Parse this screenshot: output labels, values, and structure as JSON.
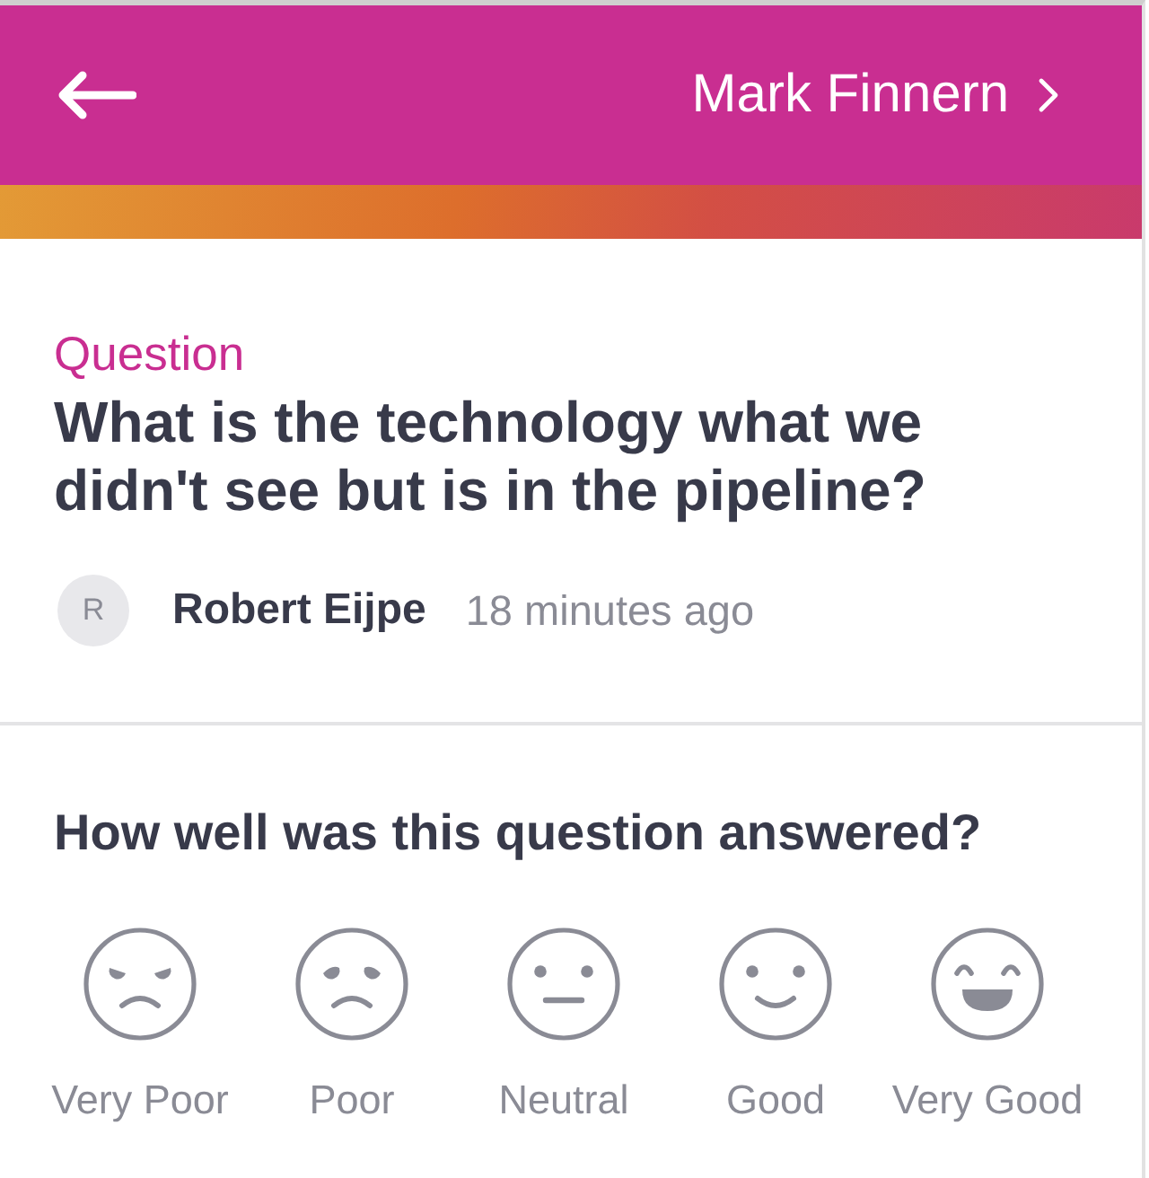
{
  "header": {
    "profile_name": "Mark Finnern"
  },
  "question": {
    "label": "Question",
    "text": "What is the technology what we didn't see but is in the pipeline?",
    "author": {
      "initial": "R",
      "name": "Robert Eijpe"
    },
    "time": "18 minutes ago"
  },
  "rating": {
    "prompt": "How well was this question answered?",
    "options": [
      {
        "kind": "very-poor",
        "label": "Very Poor",
        "selected": false
      },
      {
        "kind": "poor",
        "label": "Poor",
        "selected": false
      },
      {
        "kind": "neutral",
        "label": "Neutral",
        "selected": false
      },
      {
        "kind": "good",
        "label": "Good",
        "selected": false
      },
      {
        "kind": "very-good",
        "label": "Very Good",
        "selected": false
      }
    ]
  }
}
